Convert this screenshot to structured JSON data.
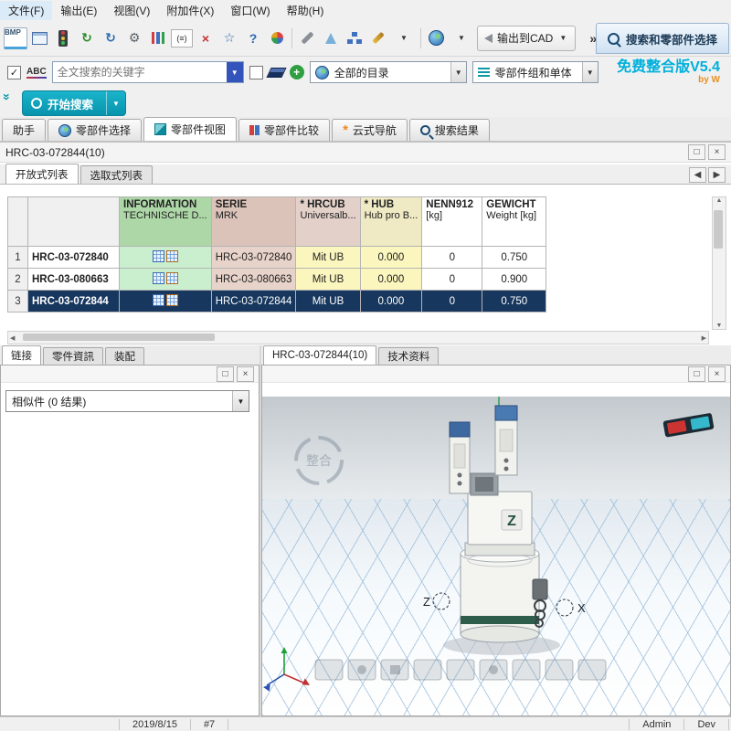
{
  "menu": {
    "items": [
      "文件(F)",
      "输出(E)",
      "视图(V)",
      "附加件(X)",
      "窗口(W)",
      "帮助(H)"
    ]
  },
  "glyphs": {
    "bmp": "BMP",
    "refresh": "↻",
    "gear": "⚙",
    "formula": "(≡)",
    "delete": "×",
    "star": "☆",
    "question": "?",
    "dropdown": "▼",
    "overflow": "»",
    "collapse": "»",
    "check": "✓",
    "plus": "+",
    "maximize": "□",
    "close": "×",
    "arrow_left": "◀",
    "arrow_right": "▶",
    "arrow_up": "▲",
    "arrow_down": "▼",
    "spark": "*"
  },
  "toolbar": {
    "output_cad_label": "输出到CAD",
    "panel_title": "搜索和零部件选择"
  },
  "search": {
    "abc_label": "ABC",
    "keyword_placeholder": "全文搜索的关键字",
    "catalog_value": "全部的目录",
    "scope_value": "零部件组和单体",
    "version": "免费整合版V5.4",
    "version_sub": "by W",
    "start_button": "开始搜索"
  },
  "main_tabs": [
    {
      "label": "助手"
    },
    {
      "label": "零部件选择"
    },
    {
      "label": "零部件视图"
    },
    {
      "label": "零部件比较"
    },
    {
      "label": "云式导航"
    },
    {
      "label": "搜索结果"
    }
  ],
  "part_panel": {
    "title": "HRC-03-072844(10)",
    "subtabs": [
      "开放式列表",
      "选取式列表"
    ]
  },
  "table": {
    "headers": [
      {
        "l1": "INFORMATION",
        "l2": "TECHNISCHE D..."
      },
      {
        "l1": "SERIE",
        "l2": "MRK"
      },
      {
        "l1": "* HRCUB",
        "l2": "Universalb..."
      },
      {
        "l1": "* HUB",
        "l2": "Hub pro B..."
      },
      {
        "l1": "NENN912",
        "l2": "[kg]"
      },
      {
        "l1": "GEWICHT",
        "l2": "Weight [kg]"
      }
    ],
    "rows": [
      {
        "num": "1",
        "name": "HRC-03-072840",
        "serie": "HRC-03-072840",
        "hrcub": "Mit UB",
        "hub": "0.000",
        "nenn912": "0",
        "gewicht": "0.750"
      },
      {
        "num": "2",
        "name": "HRC-03-080663",
        "serie": "HRC-03-080663",
        "hrcub": "Mit UB",
        "hub": "0.000",
        "nenn912": "0",
        "gewicht": "0.900"
      },
      {
        "num": "3",
        "name": "HRC-03-072844",
        "serie": "HRC-03-072844",
        "hrcub": "Mit UB",
        "hub": "0.000",
        "nenn912": "0",
        "gewicht": "0.750"
      }
    ],
    "selected_row_index": 2
  },
  "links_panel": {
    "tabs": [
      "链接",
      "零件資訊",
      "装配"
    ],
    "similar_value": "相似件 (0 结果)"
  },
  "viewer": {
    "tabs": [
      "HRC-03-072844(10)",
      "技术资料"
    ],
    "axis_z": "Z",
    "axis_x": "X",
    "model_logo": "Z",
    "watermark": "整合"
  },
  "status": {
    "date": "2019/8/15",
    "counter": "#7",
    "user": "Admin",
    "mode": "Dev"
  },
  "colors": {
    "accent_teal": "#0a9aa8",
    "version_cyan": "#00b0dc",
    "selected_row": "#17375e",
    "info_green": "#c9efcf",
    "serie_rose": "#e8d3ca",
    "hub_yellow": "#fbf6bd"
  }
}
